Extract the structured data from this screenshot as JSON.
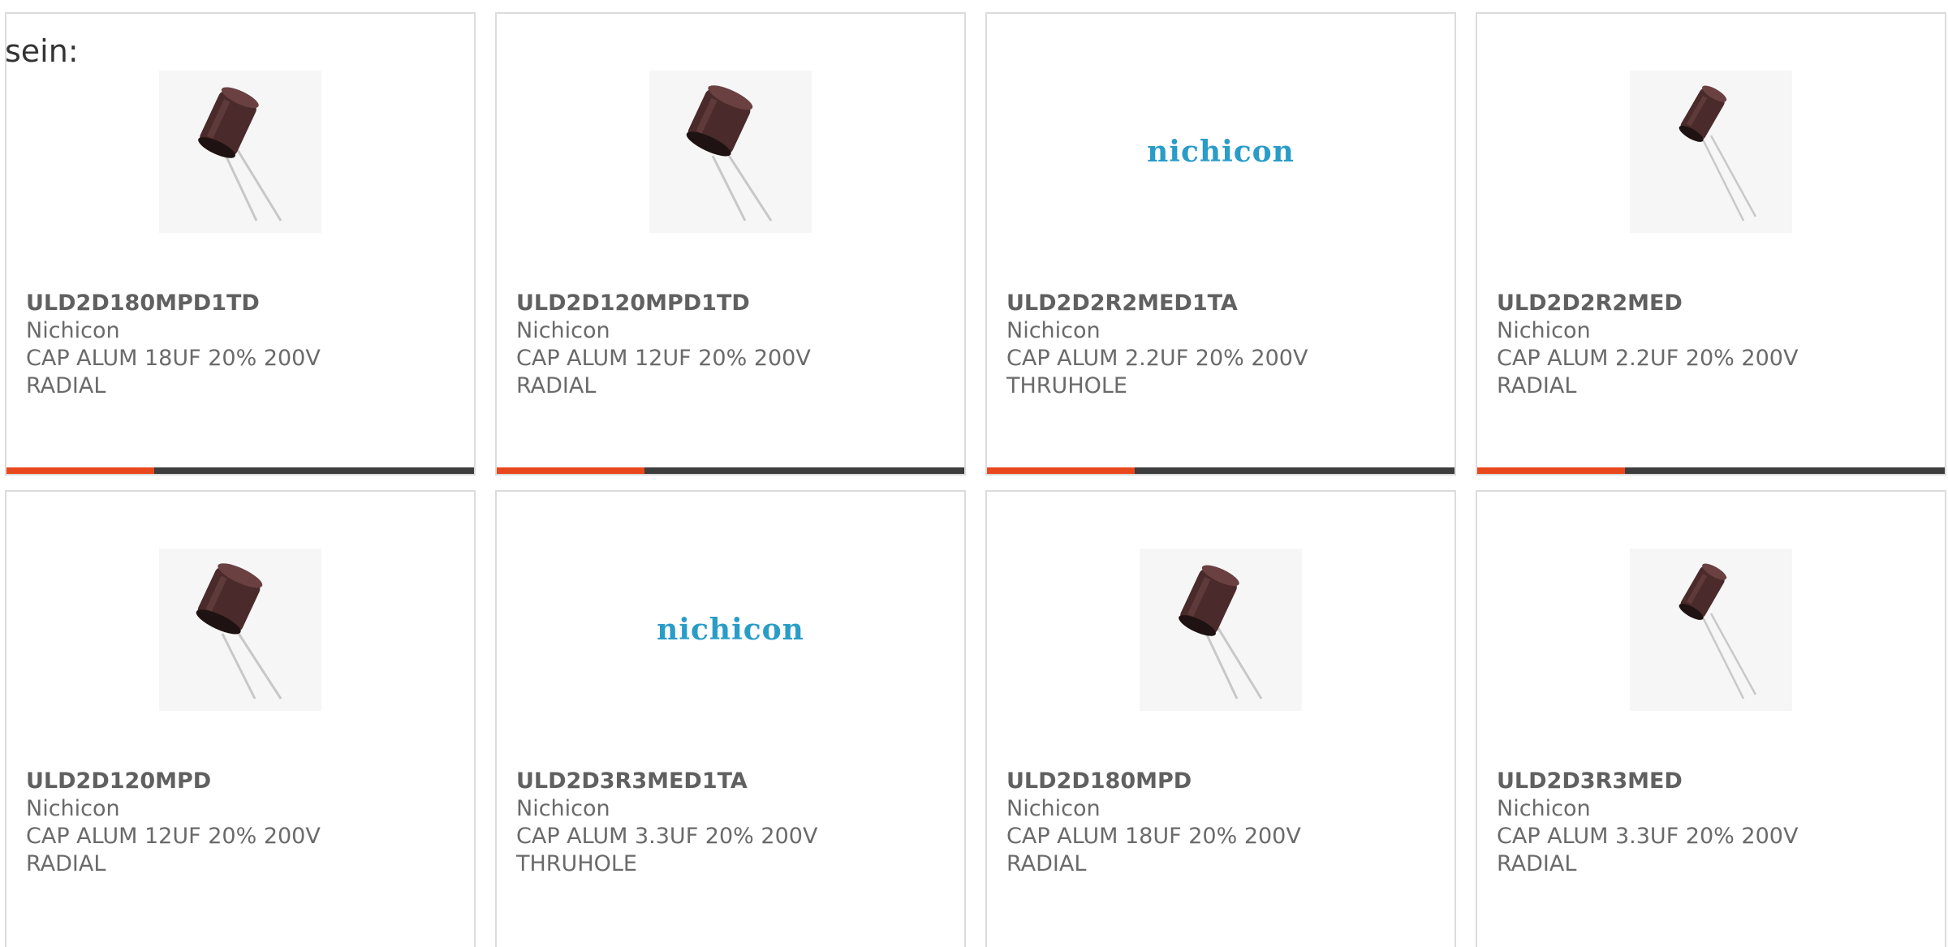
{
  "lead_text": "sein:",
  "colors": {
    "accent": "#e8481c",
    "bar": "#3d3d3d",
    "logo": "#2a9cc8"
  },
  "products": [
    {
      "part": "ULD2D180MPD1TD",
      "manufacturer": "Nichicon",
      "desc1": "CAP ALUM 18UF 20% 200V",
      "desc2": "RADIAL",
      "image": "capacitor-photo"
    },
    {
      "part": "ULD2D120MPD1TD",
      "manufacturer": "Nichicon",
      "desc1": "CAP ALUM 12UF 20% 200V",
      "desc2": "RADIAL",
      "image": "capacitor-photo"
    },
    {
      "part": "ULD2D2R2MED1TA",
      "manufacturer": "Nichicon",
      "desc1": "CAP ALUM 2.2UF 20% 200V",
      "desc2": "THRUHOLE",
      "image": "nichicon-logo",
      "logo_text": "nichicon"
    },
    {
      "part": "ULD2D2R2MED",
      "manufacturer": "Nichicon",
      "desc1": "CAP ALUM 2.2UF 20% 200V",
      "desc2": "RADIAL",
      "image": "capacitor-photo"
    },
    {
      "part": "ULD2D120MPD",
      "manufacturer": "Nichicon",
      "desc1": "CAP ALUM 12UF 20% 200V",
      "desc2": "RADIAL",
      "image": "capacitor-photo"
    },
    {
      "part": "ULD2D3R3MED1TA",
      "manufacturer": "Nichicon",
      "desc1": "CAP ALUM 3.3UF 20% 200V",
      "desc2": "THRUHOLE",
      "image": "nichicon-logo",
      "logo_text": "nichicon"
    },
    {
      "part": "ULD2D180MPD",
      "manufacturer": "Nichicon",
      "desc1": "CAP ALUM 18UF 20% 200V",
      "desc2": "RADIAL",
      "image": "capacitor-photo"
    },
    {
      "part": "ULD2D3R3MED",
      "manufacturer": "Nichicon",
      "desc1": "CAP ALUM 3.3UF 20% 200V",
      "desc2": "RADIAL",
      "image": "capacitor-photo"
    }
  ]
}
